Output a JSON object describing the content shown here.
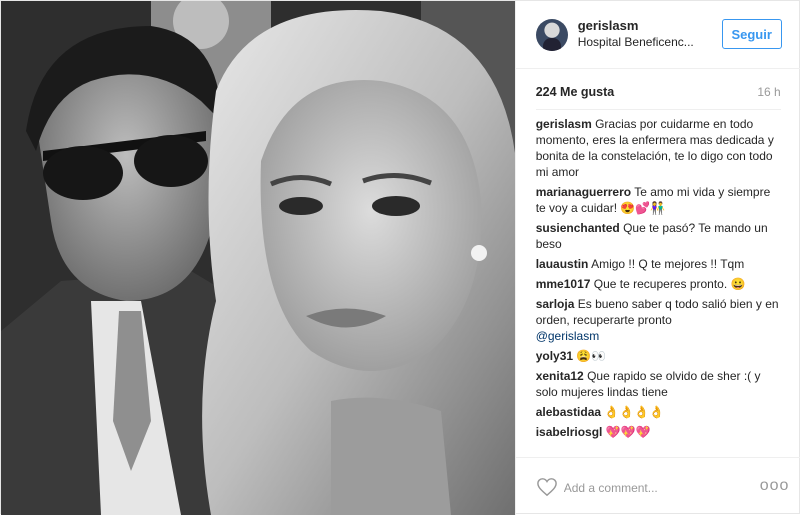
{
  "post": {
    "username": "gerislasm",
    "location": "Hospital Beneficenc...",
    "follow_label": "Seguir",
    "likes": "224 Me gusta",
    "time": "16 h",
    "comments": [
      {
        "user": "gerislasm",
        "text": "Gracias por cuidarme en todo momento, eres la enfermera mas dedicada y bonita de la constelación, te lo digo con todo mi amor"
      },
      {
        "user": "marianaguerrero",
        "text": "Te amo mi vida y siempre te voy a cuidar! 😍💕👫"
      },
      {
        "user": "susienchanted",
        "text": "Que te pasó? Te mando un beso"
      },
      {
        "user": "lauaustin",
        "text": "Amigo !! Q te mejores !! Tqm"
      },
      {
        "user": "mme1017",
        "text": "Que te recuperes pronto. 😀"
      },
      {
        "user": "sarloja",
        "text": "Es bueno saber q todo salió bien y en orden, recuperarte pronto",
        "mention": "@gerislasm"
      },
      {
        "user": "yoly31",
        "text": "😩👀"
      },
      {
        "user": "xenita12",
        "text": "Que rapido se olvido de sher :( y solo mujeres lindas tiene"
      },
      {
        "user": "alebastidaa",
        "text": "👌👌👌👌"
      },
      {
        "user": "isabelriosgl",
        "text": "💖💖💖"
      }
    ],
    "add_comment_placeholder": "Add a comment...",
    "more_label": "ooo"
  },
  "icons": {
    "like": "heart-icon",
    "options": "more-options-icon"
  },
  "colors": {
    "follow_blue": "#3897f0",
    "border": "#efefef",
    "muted": "#999999"
  }
}
